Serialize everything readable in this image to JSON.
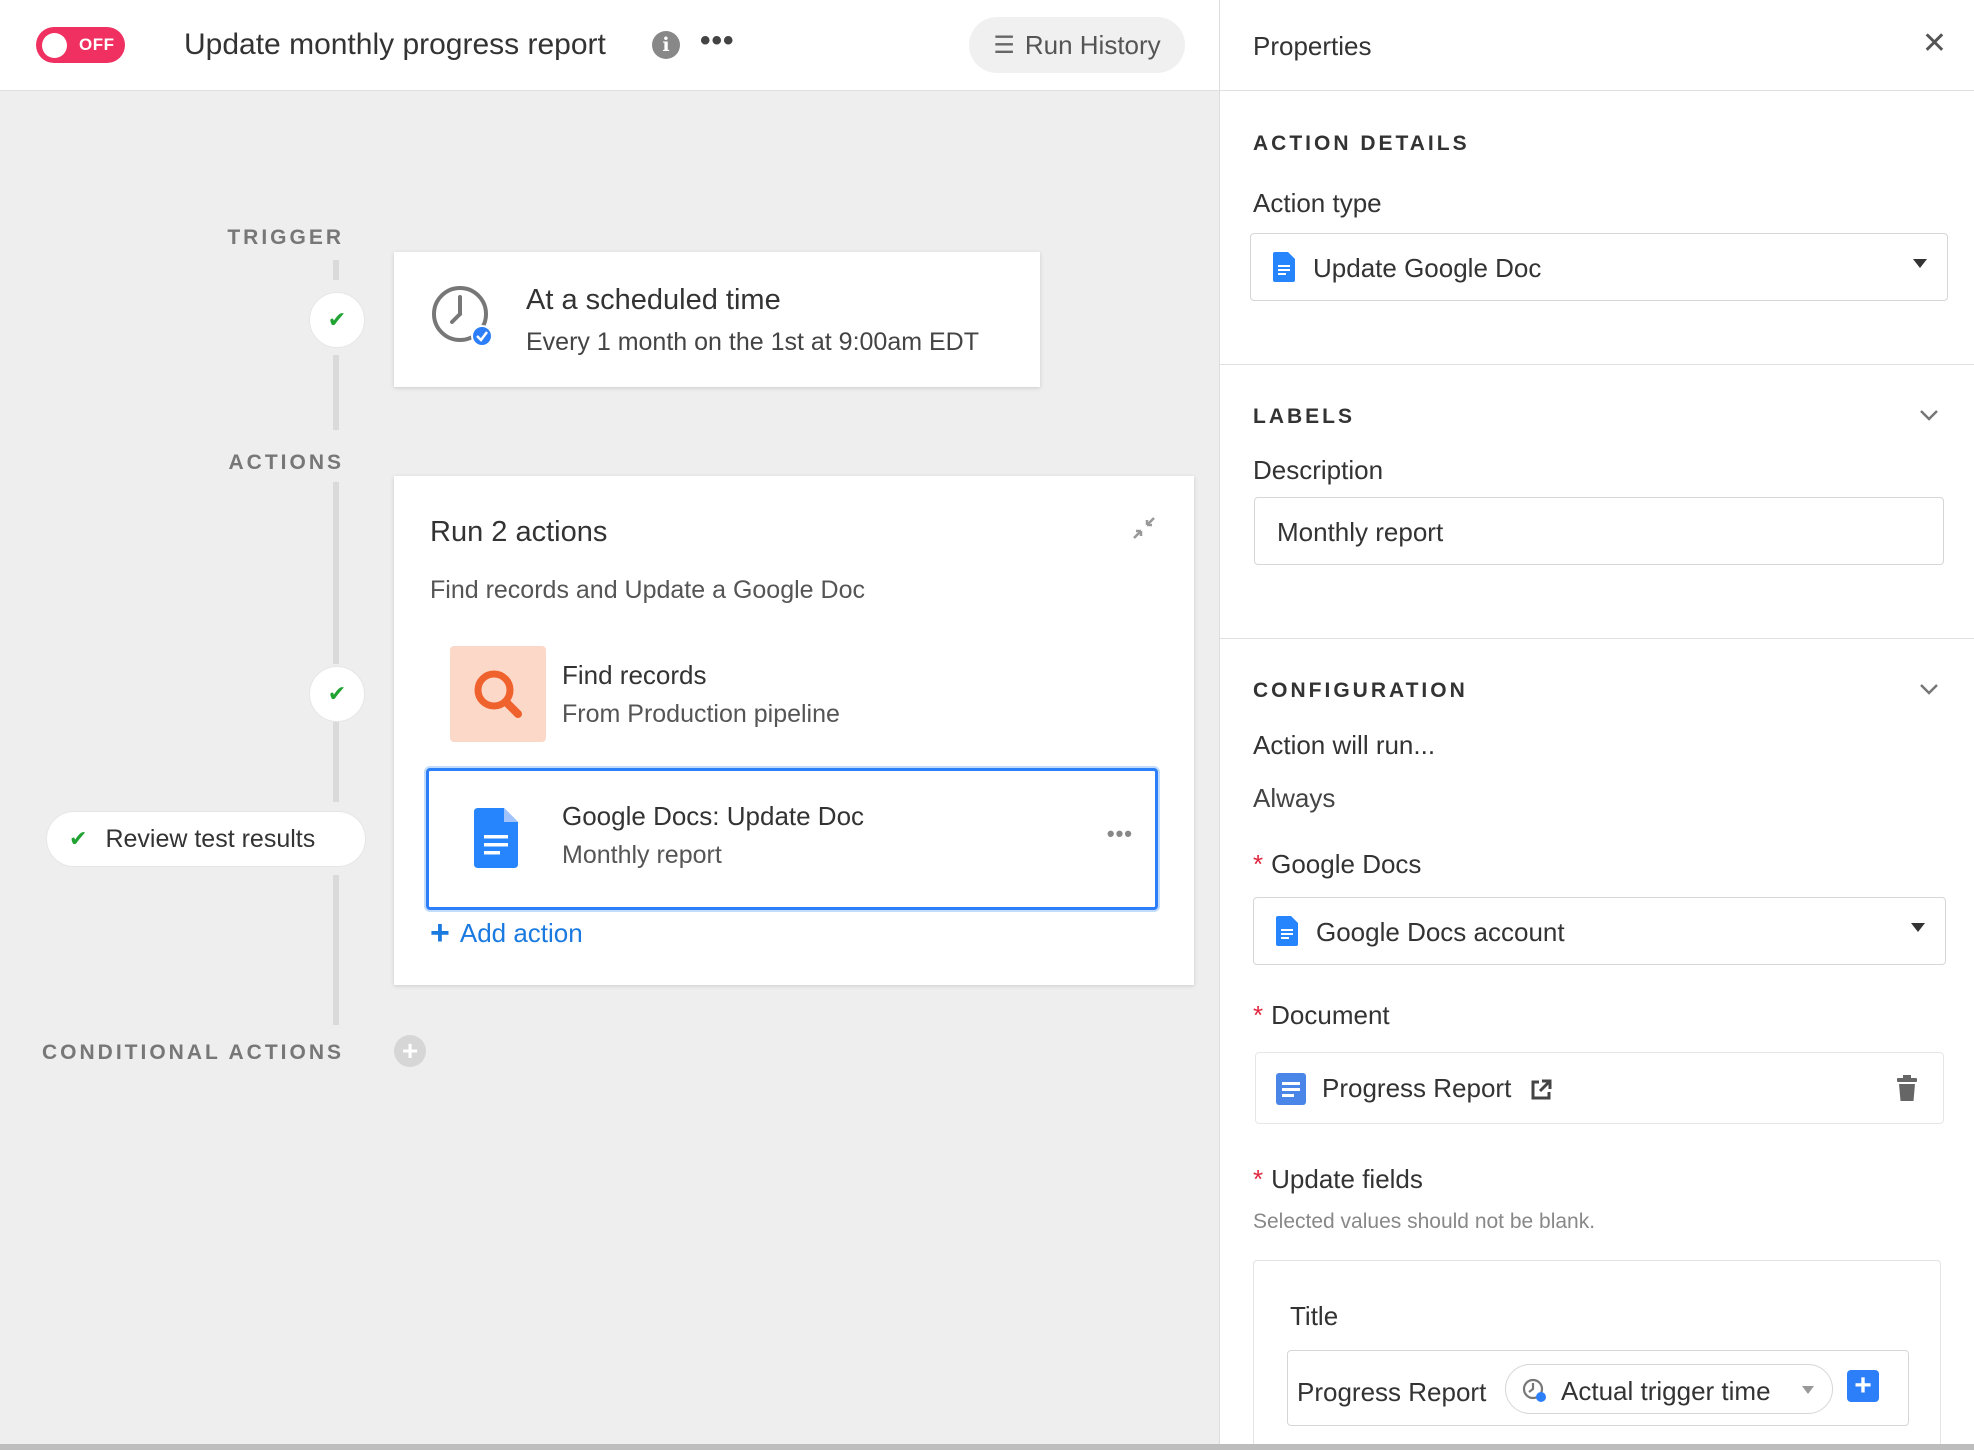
{
  "header": {
    "toggle_label": "OFF",
    "workflow_title": "Update monthly progress report",
    "info_icon": "info-icon",
    "more_icon": "more-horizontal-icon",
    "run_history_label": "Run History"
  },
  "workflow": {
    "trigger_label": "TRIGGER",
    "actions_label": "ACTIONS",
    "conditional_label": "CONDITIONAL ACTIONS",
    "trigger": {
      "title": "At a scheduled time",
      "subtitle": "Every 1 month on the 1st at 9:00am EDT",
      "icon": "clock-icon"
    },
    "actions_group": {
      "title": "Run 2 actions",
      "subtitle": "Find records and Update a Google Doc",
      "steps": [
        {
          "title": "Find records",
          "subtitle": "From Production pipeline",
          "icon": "search-icon"
        },
        {
          "title": "Google Docs: Update Doc",
          "subtitle": "Monthly report",
          "icon": "google-doc-icon"
        }
      ],
      "add_action_label": "Add action"
    },
    "review_label": "Review test results"
  },
  "properties": {
    "title": "Properties",
    "action_details": {
      "section_label": "ACTION DETAILS",
      "action_type_label": "Action type",
      "action_type_value": "Update Google Doc"
    },
    "labels": {
      "section_label": "LABELS",
      "description_label": "Description",
      "description_value": "Monthly report"
    },
    "configuration": {
      "section_label": "CONFIGURATION",
      "run_condition_label": "Action will run...",
      "run_condition_value": "Always",
      "google_docs_label": "Google Docs",
      "google_docs_value": "Google Docs account",
      "document_label": "Document",
      "document_value": "Progress Report",
      "update_fields_label": "Update fields",
      "update_fields_help": "Selected values should not be blank.",
      "field_title_label": "Title",
      "field_title_text": "Progress Report",
      "field_title_token": "Actual trigger time"
    }
  },
  "colors": {
    "toggle_off": "#ef3061",
    "accent_blue": "#2d7ff9",
    "success_green": "#21a334",
    "google_doc_blue": "#2684fc",
    "find_orange": "#f0622d"
  }
}
